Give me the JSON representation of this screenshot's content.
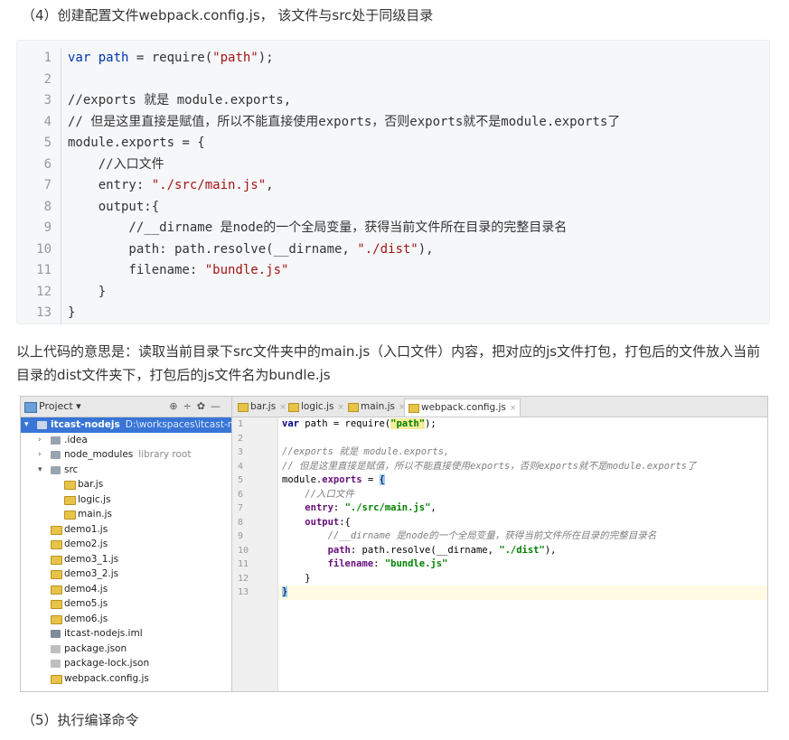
{
  "heading_step4": "（4）创建配置文件webpack.config.js， 该文件与src处于同级目录",
  "code_lines": [
    "var path = require(\"path\");",
    "",
    "//exports 就是 module.exports,",
    "// 但是这里直接是赋值，所以不能直接使用exports，否则exports就不是module.exports了",
    "module.exports = {",
    "    //入口文件",
    "    entry: \"./src/main.js\",",
    "    output:{",
    "        //__dirname 是node的一个全局变量，获得当前文件所在目录的完整目录名",
    "        path: path.resolve(__dirname, \"./dist\"),",
    "        filename: \"bundle.js\"",
    "    }",
    "}"
  ],
  "line_numbers": [
    "1",
    "2",
    "3",
    "4",
    "5",
    "6",
    "7",
    "8",
    "9",
    "10",
    "11",
    "12",
    "13"
  ],
  "explanation": "以上代码的意思是：读取当前目录下src文件夹中的main.js（入口文件）内容，把对应的js文件打包，打包后的文件放入当前目录的dist文件夹下，打包后的js文件名为bundle.js",
  "ide": {
    "project_label": "Project",
    "toolbar_icons": [
      "gear-icon",
      "collapse-icon",
      "settings-icon",
      "minimize-icon"
    ],
    "tree": [
      {
        "label": "itcast-nodejs",
        "path": "D:\\workspaces\\itcast-nodejs",
        "level": 0,
        "type": "root",
        "expanded": true
      },
      {
        "label": ".idea",
        "level": 1,
        "type": "folder",
        "expanded": false
      },
      {
        "label": "node_modules",
        "hint": "library root",
        "level": 1,
        "type": "folder",
        "expanded": false
      },
      {
        "label": "src",
        "level": 1,
        "type": "folder",
        "expanded": true
      },
      {
        "label": "bar.js",
        "level": 2,
        "type": "js"
      },
      {
        "label": "logic.js",
        "level": 2,
        "type": "js"
      },
      {
        "label": "main.js",
        "level": 2,
        "type": "js"
      },
      {
        "label": "demo1.js",
        "level": 1,
        "type": "js"
      },
      {
        "label": "demo2.js",
        "level": 1,
        "type": "js"
      },
      {
        "label": "demo3_1.js",
        "level": 1,
        "type": "js"
      },
      {
        "label": "demo3_2.js",
        "level": 1,
        "type": "js"
      },
      {
        "label": "demo4.js",
        "level": 1,
        "type": "js"
      },
      {
        "label": "demo5.js",
        "level": 1,
        "type": "js"
      },
      {
        "label": "demo6.js",
        "level": 1,
        "type": "js"
      },
      {
        "label": "itcast-nodejs.iml",
        "level": 1,
        "type": "iml"
      },
      {
        "label": "package.json",
        "level": 1,
        "type": "json"
      },
      {
        "label": "package-lock.json",
        "level": 1,
        "type": "json"
      },
      {
        "label": "webpack.config.js",
        "level": 1,
        "type": "js"
      }
    ],
    "tabs": [
      {
        "label": "bar.js",
        "active": false
      },
      {
        "label": "logic.js",
        "active": false
      },
      {
        "label": "main.js",
        "active": false
      },
      {
        "label": "webpack.config.js",
        "active": true
      }
    ]
  },
  "heading_step5": "（5）执行编译命令"
}
